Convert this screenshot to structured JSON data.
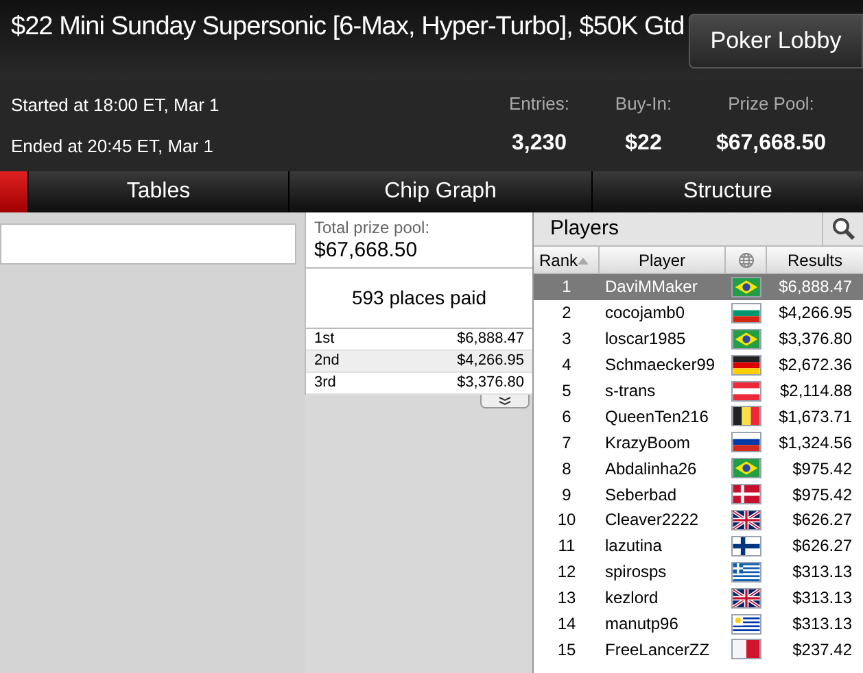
{
  "window": {
    "title": "$22 Mini Sunday Supersonic [6-Max, Hyper-Turbo], $50K Gtd"
  },
  "lobby_button": "Poker Lobby",
  "info": {
    "started": "Started at 18:00 ET, Mar 1",
    "ended": "Ended at 20:45 ET, Mar 1",
    "stats": [
      {
        "label": "Entries:",
        "value": "3,230"
      },
      {
        "label": "Buy-In:",
        "value": "$22"
      },
      {
        "label": "Prize Pool:",
        "value": "$67,668.50"
      }
    ]
  },
  "tabs": [
    {
      "selected": true
    },
    {
      "label": "Tables",
      "selected": false
    },
    {
      "label": "Chip Graph",
      "selected": false
    },
    {
      "label": "Structure",
      "selected": false
    }
  ],
  "prizes": {
    "total_label": "Total prize pool:",
    "total": "$67,668.50",
    "places_paid": "593 places paid",
    "rows": [
      {
        "place": "1st",
        "amount": "$6,888.47"
      },
      {
        "place": "2nd",
        "amount": "$4,266.95"
      },
      {
        "place": "3rd",
        "amount": "$3,376.80"
      }
    ]
  },
  "players": {
    "title": "Players",
    "columns": [
      "Rank",
      "Player",
      "Results"
    ],
    "rows": [
      {
        "rank": "1",
        "name": "DaviMMaker",
        "kind": "br",
        "result": "$6,888.47",
        "selected": true
      },
      {
        "rank": "2",
        "name": "cocojamb0",
        "kind": "bg",
        "result": "$4,266.95",
        "selected": false
      },
      {
        "rank": "3",
        "name": "loscar1985",
        "kind": "br",
        "result": "$3,376.80",
        "selected": false
      },
      {
        "rank": "4",
        "name": "Schmaecker99",
        "kind": "de",
        "result": "$2,672.36",
        "selected": false
      },
      {
        "rank": "5",
        "name": "s-trans",
        "kind": "at",
        "result": "$2,114.88",
        "selected": false
      },
      {
        "rank": "6",
        "name": "QueenTen216",
        "kind": "be",
        "result": "$1,673.71",
        "selected": false
      },
      {
        "rank": "7",
        "name": "KrazyBoom",
        "kind": "ru",
        "result": "$1,324.56",
        "selected": false
      },
      {
        "rank": "8",
        "name": "Abdalinha26",
        "kind": "br",
        "result": "$975.42",
        "selected": false
      },
      {
        "rank": "9",
        "name": "Seberbad",
        "kind": "dk",
        "result": "$975.42",
        "selected": false
      },
      {
        "rank": "10",
        "name": "Cleaver2222",
        "kind": "gb",
        "result": "$626.27",
        "selected": false
      },
      {
        "rank": "11",
        "name": "lazutina",
        "kind": "fi",
        "result": "$626.27",
        "selected": false
      },
      {
        "rank": "12",
        "name": "spirosps",
        "kind": "gr",
        "result": "$313.13",
        "selected": false
      },
      {
        "rank": "13",
        "name": "kezlord",
        "kind": "gb",
        "result": "$313.13",
        "selected": false
      },
      {
        "rank": "14",
        "name": "manutp96",
        "kind": "uy",
        "result": "$313.13",
        "selected": false
      },
      {
        "rank": "15",
        "name": "FreeLancerZZ",
        "kind": "mt",
        "result": "$237.42",
        "selected": false
      }
    ]
  }
}
